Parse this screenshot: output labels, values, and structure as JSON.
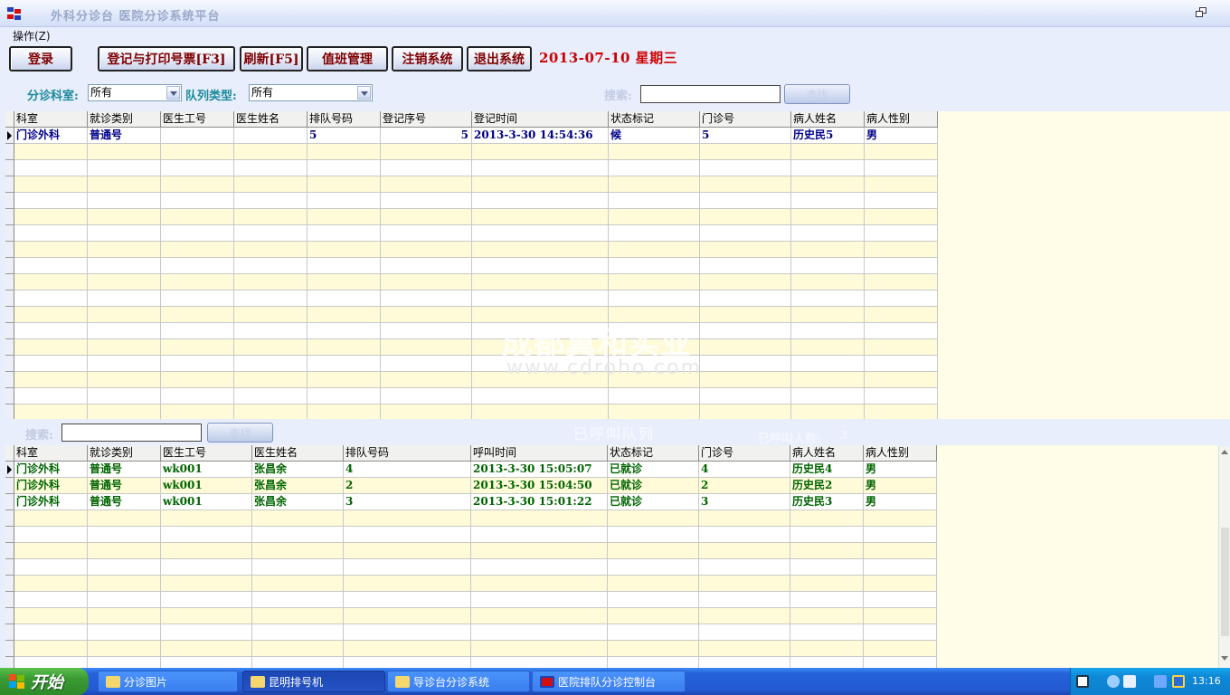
{
  "window": {
    "title": "外科分诊台  医院分诊系统平台"
  },
  "menu": {
    "operation": "操作(Z)"
  },
  "toolbar": {
    "login": "登录",
    "register_print": "登记与打印号票[F3]",
    "refresh": "刷新[F5]",
    "duty": "值班管理",
    "logout": "注销系统",
    "exit": "退出系统",
    "date": "2013-07-10  星期三"
  },
  "filters": {
    "dept_label": "分诊科室:",
    "dept_value": "所有",
    "queue_label": "队列类型:",
    "queue_value": "所有",
    "search_label": "搜索:",
    "query_button": "查找"
  },
  "waiting_grid": {
    "columns": [
      "科室",
      "就诊类别",
      "医生工号",
      "医生姓名",
      "排队号码",
      "登记序号",
      "登记时间",
      "状态标记",
      "门诊号",
      "病人姓名",
      "病人性别"
    ],
    "rows": [
      [
        "门诊外科",
        "普通号",
        "",
        "",
        "5",
        "5",
        "2013-3-30 14:54:36",
        "候",
        "5",
        "历史民5",
        "男"
      ]
    ]
  },
  "called": {
    "search_label": "搜索:",
    "query_button": "查找",
    "title": "已呼叫队列",
    "count_label": "已呼叫人数:",
    "count": "3"
  },
  "called_grid": {
    "columns": [
      "科室",
      "就诊类别",
      "医生工号",
      "医生姓名",
      "排队号码",
      "呼叫时间",
      "状态标记",
      "门诊号",
      "病人姓名",
      "病人性别"
    ],
    "rows": [
      [
        "门诊外科",
        "普通号",
        "wk001",
        "张昌余",
        "4",
        "2013-3-30 15:05:07",
        "已就诊",
        "4",
        "历史民4",
        "男"
      ],
      [
        "门诊外科",
        "普通号",
        "wk001",
        "张昌余",
        "2",
        "2013-3-30 15:04:50",
        "已就诊",
        "2",
        "历史民2",
        "男"
      ],
      [
        "门诊外科",
        "普通号",
        "wk001",
        "张昌余",
        "3",
        "2013-3-30 15:01:22",
        "已就诊",
        "3",
        "历史民3",
        "男"
      ]
    ]
  },
  "watermark": {
    "line1": "成都翼和实业",
    "line2": "www.cdroho.com"
  },
  "taskbar": {
    "start": "开始",
    "tasks": [
      "分诊图片",
      "昆明排号机",
      "导诊台分诊系统",
      "医院排队分诊控制台"
    ],
    "time": "13:16"
  },
  "colors": {
    "grid_bg": "#fffde8",
    "alt_row": "#fffbd8",
    "waiting_text": "#00008b",
    "called_text": "#006400",
    "date_red": "#d00000",
    "button_text": "#800000"
  }
}
